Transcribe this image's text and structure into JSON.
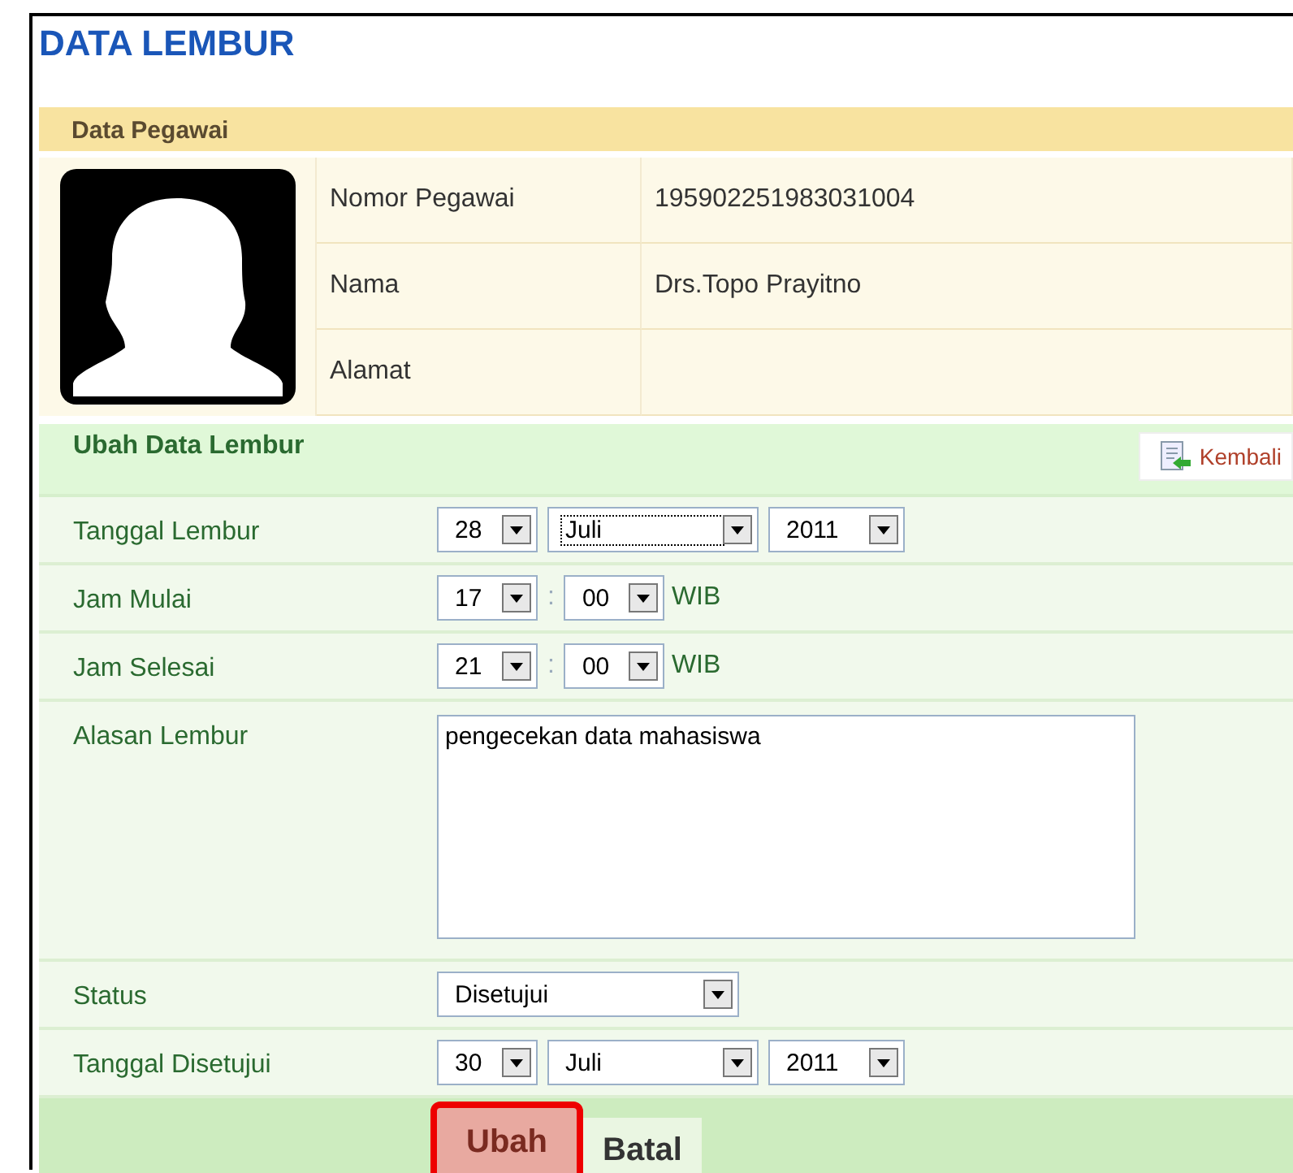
{
  "title": "DATA LEMBUR",
  "employee": {
    "header": "Data Pegawai",
    "rows": [
      {
        "label": "Nomor Pegawai",
        "value": "195902251983031004"
      },
      {
        "label": "Nama",
        "value": "Drs.Topo Prayitno"
      },
      {
        "label": "Alamat"
      }
    ]
  },
  "form": {
    "header": "Ubah Data Lembur",
    "back_button": "Kembali",
    "fields": [
      {
        "kind": "date",
        "label": "Tanggal Lembur",
        "selects": [
          {
            "value": "28",
            "focused": false
          },
          {
            "value": "Juli",
            "focused": true
          },
          {
            "value": "2011",
            "focused": false
          }
        ]
      },
      {
        "kind": "time",
        "label": "Jam Mulai",
        "selects": [
          {
            "value": "17",
            "focused": false
          },
          {
            "value": "00",
            "focused": false
          }
        ],
        "separator": ":",
        "suffix": "WIB"
      },
      {
        "kind": "time",
        "label": "Jam Selesai",
        "selects": [
          {
            "value": "21",
            "focused": false
          },
          {
            "value": "00",
            "focused": false
          }
        ],
        "separator": ":",
        "suffix": "WIB"
      },
      {
        "kind": "textarea",
        "label": "Alasan Lembur",
        "value": "pengecekan data mahasiswa"
      },
      {
        "kind": "select",
        "label": "Status",
        "selects": [
          {
            "value": "Disetujui",
            "focused": false
          }
        ]
      },
      {
        "kind": "date",
        "label": "Tanggal Disetujui",
        "selects": [
          {
            "value": "30",
            "focused": false
          },
          {
            "value": "Juli",
            "focused": false
          },
          {
            "value": "2011",
            "focused": false
          }
        ]
      }
    ],
    "buttons": [
      {
        "label": "Ubah",
        "focused": true
      },
      {
        "label": "Batal",
        "focused": false
      }
    ]
  }
}
